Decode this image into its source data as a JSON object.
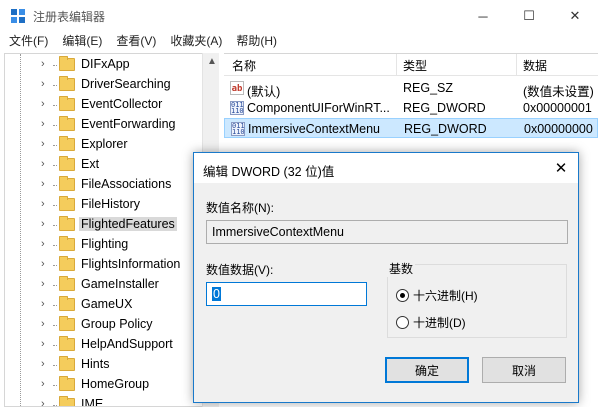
{
  "window": {
    "title": "注册表编辑器",
    "minimize": "─",
    "maximize": "☐",
    "close": "✕"
  },
  "menu": [
    "文件(F)",
    "编辑(E)",
    "查看(V)",
    "收藏夹(A)",
    "帮助(H)"
  ],
  "tree": {
    "items": [
      {
        "label": "DIFxApp",
        "selected": false
      },
      {
        "label": "DriverSearching",
        "selected": false
      },
      {
        "label": "EventCollector",
        "selected": false
      },
      {
        "label": "EventForwarding",
        "selected": false
      },
      {
        "label": "Explorer",
        "selected": false
      },
      {
        "label": "Ext",
        "selected": false
      },
      {
        "label": "FileAssociations",
        "selected": false
      },
      {
        "label": "FileHistory",
        "selected": false
      },
      {
        "label": "FlightedFeatures",
        "selected": true
      },
      {
        "label": "Flighting",
        "selected": false
      },
      {
        "label": "FlightsInformation",
        "selected": false
      },
      {
        "label": "GameInstaller",
        "selected": false
      },
      {
        "label": "GameUX",
        "selected": false
      },
      {
        "label": "Group Policy",
        "selected": false
      },
      {
        "label": "HelpAndSupport",
        "selected": false
      },
      {
        "label": "Hints",
        "selected": false
      },
      {
        "label": "HomeGroup",
        "selected": false
      },
      {
        "label": "IME",
        "selected": false
      }
    ],
    "expand_glyph": "›",
    "scroll_up": "▲"
  },
  "list": {
    "columns": [
      "名称",
      "类型",
      "数据"
    ],
    "rows": [
      {
        "icon": "ab",
        "name": "(默认)",
        "type": "REG_SZ",
        "data": "(数值未设置)",
        "selected": false
      },
      {
        "icon": "bin",
        "name": "ComponentUIForWinRT...",
        "type": "REG_DWORD",
        "data": "0x00000001",
        "selected": false
      },
      {
        "icon": "bin",
        "name": "ImmersiveContextMenu",
        "type": "REG_DWORD",
        "data": "0x00000000",
        "selected": true
      }
    ],
    "icon_text": {
      "ab": "ab",
      "bin": "011 110"
    }
  },
  "dialog": {
    "title": "编辑 DWORD (32 位)值",
    "close": "✕",
    "name_label": "数值名称(N):",
    "name_value": "ImmersiveContextMenu",
    "data_label": "数值数据(V):",
    "data_value": "0",
    "base_label": "基数",
    "hex_label": "十六进制(H)",
    "dec_label": "十进制(D)",
    "base_selected": "hex",
    "ok": "确定",
    "cancel": "取消"
  },
  "colors": {
    "accent": "#0078d7",
    "selection": "#cce8ff",
    "folder": "#f4cc5c"
  }
}
